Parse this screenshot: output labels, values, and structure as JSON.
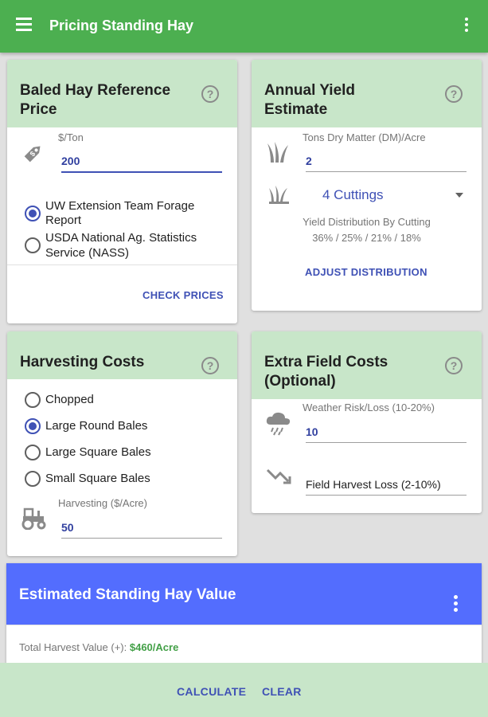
{
  "appbar": {
    "title": "Pricing Standing Hay"
  },
  "baled": {
    "title_line1": "Baled Hay Reference",
    "title_line2": "Price",
    "help": "?",
    "price_label": "$/Ton",
    "price_value": "200",
    "options": [
      {
        "line1": "UW Extension Team Forage",
        "line2": "Report",
        "selected": true
      },
      {
        "line1": "USDA National Ag. Statistics",
        "line2": "Service (NASS)",
        "selected": false
      }
    ],
    "check_prices": "CHECK PRICES"
  },
  "yield": {
    "title_line1": "Annual Yield",
    "title_line2": "Estimate",
    "help": "?",
    "tons_label": "Tons Dry Matter (DM)/Acre",
    "tons_value": "2",
    "cuttings": "4 Cuttings",
    "distribution_label": "Yield Distribution By Cutting",
    "distribution_values": "36% / 25% / 21% / 18%",
    "adjust": "ADJUST DISTRIBUTION"
  },
  "harvesting": {
    "title": "Harvesting Costs",
    "help": "?",
    "options": [
      {
        "label": "Chopped",
        "selected": false
      },
      {
        "label": "Large Round Bales",
        "selected": true
      },
      {
        "label": "Large Square Bales",
        "selected": false
      },
      {
        "label": "Small Square Bales",
        "selected": false
      }
    ],
    "cost_label": "Harvesting ($/Acre)",
    "cost_value": "50"
  },
  "extra": {
    "title_line1": "Extra Field Costs",
    "title_line2": "(Optional)",
    "help": "?",
    "weather_label": "Weather Risk/Loss (10-20%)",
    "weather_value": "10",
    "loss_placeholder": "Field Harvest Loss (2-10%)"
  },
  "result": {
    "title": "Estimated Standing Hay Value",
    "total_label": "Total Harvest Value (+):",
    "total_value": "$460/Acre"
  },
  "actions": {
    "calculate": "CALCULATE",
    "clear": "CLEAR"
  },
  "colors": {
    "primary_green": "#4caf50",
    "light_green": "#c8e6c9",
    "accent_blue": "#3f51b5",
    "result_blue": "#536dfe",
    "value_green": "#43a047"
  }
}
